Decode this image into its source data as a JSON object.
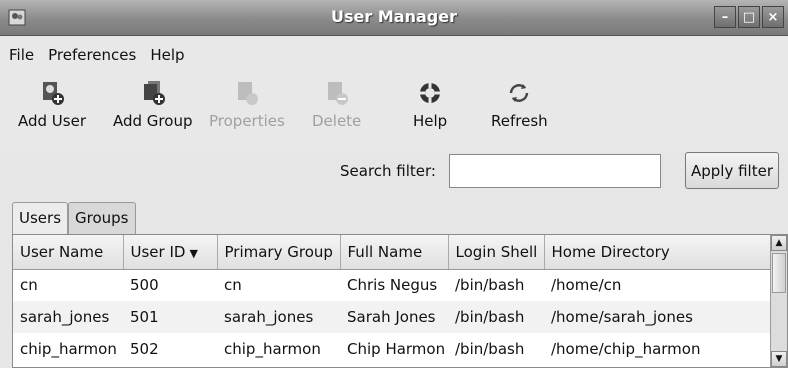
{
  "window": {
    "title": "User Manager"
  },
  "menu": {
    "items": [
      "File",
      "Preferences",
      "Help"
    ]
  },
  "toolbar": {
    "add_user": "Add User",
    "add_group": "Add Group",
    "properties": "Properties",
    "delete": "Delete",
    "help": "Help",
    "refresh": "Refresh"
  },
  "search": {
    "label": "Search filter:",
    "value": "",
    "apply_label": "Apply filter"
  },
  "tabs": [
    "Users",
    "Groups"
  ],
  "table": {
    "columns": [
      "User Name",
      "User ID",
      "Primary Group",
      "Full Name",
      "Login Shell",
      "Home Directory"
    ],
    "rows": [
      [
        "cn",
        "500",
        "cn",
        "Chris Negus",
        "/bin/bash",
        "/home/cn"
      ],
      [
        "sarah_jones",
        "501",
        "sarah_jones",
        "Sarah Jones",
        "/bin/bash",
        "/home/sarah_jones"
      ],
      [
        "chip_harmon",
        "502",
        "chip_harmon",
        "Chip Harmon",
        "/bin/bash",
        "/home/chip_harmon"
      ]
    ]
  },
  "icons": {
    "app": "app-icon",
    "minimize": "minimize-icon",
    "maximize": "maximize-icon",
    "close": "close-icon",
    "add_user": "add-user-icon",
    "add_group": "add-group-icon",
    "properties": "properties-icon",
    "delete": "delete-icon",
    "help": "help-icon",
    "refresh": "refresh-icon",
    "sort": "sort-desc-icon"
  }
}
